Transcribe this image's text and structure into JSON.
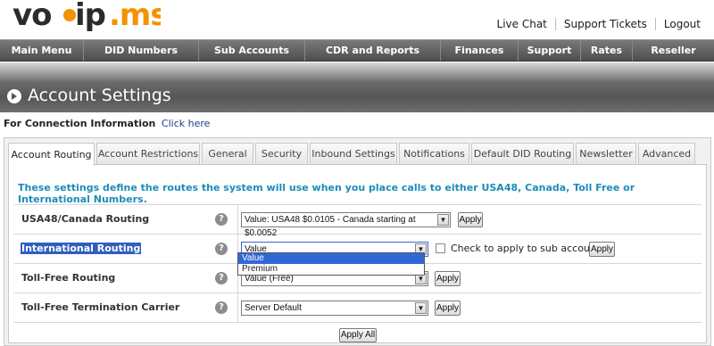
{
  "header": {
    "logo_text": "voip.ms",
    "links": [
      "Live Chat",
      "Support Tickets",
      "Logout"
    ]
  },
  "nav": [
    "Main Menu",
    "DID Numbers",
    "Sub Accounts",
    "CDR and Reports",
    "Finances",
    "Support",
    "Rates",
    "Reseller"
  ],
  "page_title": "Account Settings",
  "connection": {
    "label": "For Connection Information",
    "link": "Click here"
  },
  "tabs": [
    "Account Routing",
    "Account Restrictions",
    "General",
    "Security",
    "Inbound Settings",
    "Notifications",
    "Default DID Routing",
    "Newsletter",
    "Advanced"
  ],
  "active_tab": "Account Routing",
  "intro": "These settings define the routes the system will use when you place calls to either USA48, Canada, Toll Free or International Numbers.",
  "settings": {
    "usa": {
      "label": "USA48/Canada Routing",
      "value": "Value: USA48 $0.0105 - Canada starting at $0.0052",
      "apply": "Apply"
    },
    "intl": {
      "label": "International Routing",
      "value": "Value",
      "checkbox_label": "Check to apply to sub accounts",
      "apply": "Apply",
      "options": [
        "Value",
        "Premium"
      ]
    },
    "tollfree": {
      "label": "Toll-Free Routing",
      "value": "Value (Free)",
      "apply": "Apply"
    },
    "carrier": {
      "label": "Toll-Free Termination Carrier",
      "value": "Server Default",
      "apply": "Apply"
    }
  },
  "help_glyph": "?",
  "apply_all": "Apply All",
  "colors": {
    "accent": "#1b8db8",
    "nav": "#5a5a5a",
    "selection": "#3168d8",
    "logo_orange": "#f39200"
  }
}
